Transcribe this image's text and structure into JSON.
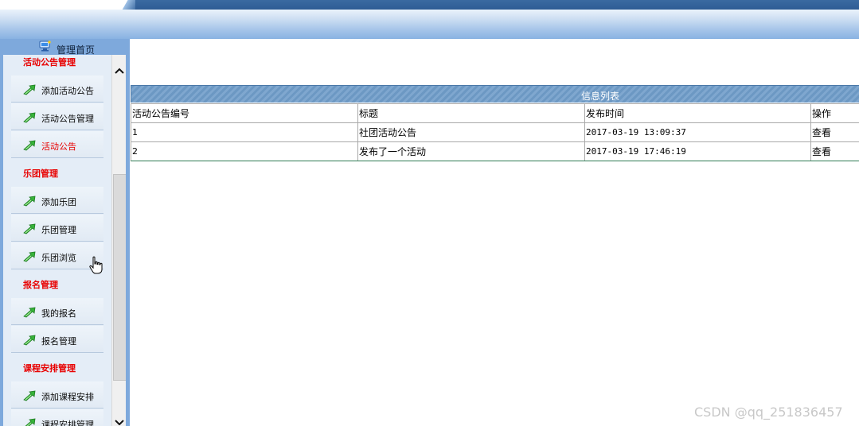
{
  "header": {
    "home_label": "管理首页"
  },
  "sidebar": {
    "items": [
      {
        "kind": "heading",
        "label": "活动公告管理"
      },
      {
        "kind": "entry",
        "label": "添加活动公告"
      },
      {
        "kind": "entry",
        "label": "活动公告管理"
      },
      {
        "kind": "entry",
        "label": "活动公告",
        "active": true
      },
      {
        "kind": "heading",
        "label": "乐团管理"
      },
      {
        "kind": "entry",
        "label": "添加乐团"
      },
      {
        "kind": "entry",
        "label": "乐团管理"
      },
      {
        "kind": "entry",
        "label": "乐团浏览"
      },
      {
        "kind": "heading",
        "label": "报名管理"
      },
      {
        "kind": "entry",
        "label": "我的报名"
      },
      {
        "kind": "entry",
        "label": "报名管理"
      },
      {
        "kind": "heading",
        "label": "课程安排管理"
      },
      {
        "kind": "entry",
        "label": "添加课程安排"
      },
      {
        "kind": "entry",
        "label": "课程安排管理"
      }
    ]
  },
  "main": {
    "list_title": "信息列表",
    "columns": [
      "活动公告编号",
      "标题",
      "发布时间",
      "操作"
    ],
    "rows": [
      {
        "id": "1",
        "title": "社团活动公告",
        "time": "2017-03-19 13:09:37",
        "action": "查看"
      },
      {
        "id": "2",
        "title": "发布了一个活动",
        "time": "2017-03-19 17:46:19",
        "action": "查看"
      }
    ]
  },
  "watermark": "CSDN @qq_251836457",
  "colors": {
    "accent_red": "#e80000",
    "header_blue": "#3b6aa1",
    "frame_blue": "#7ea9dc"
  }
}
